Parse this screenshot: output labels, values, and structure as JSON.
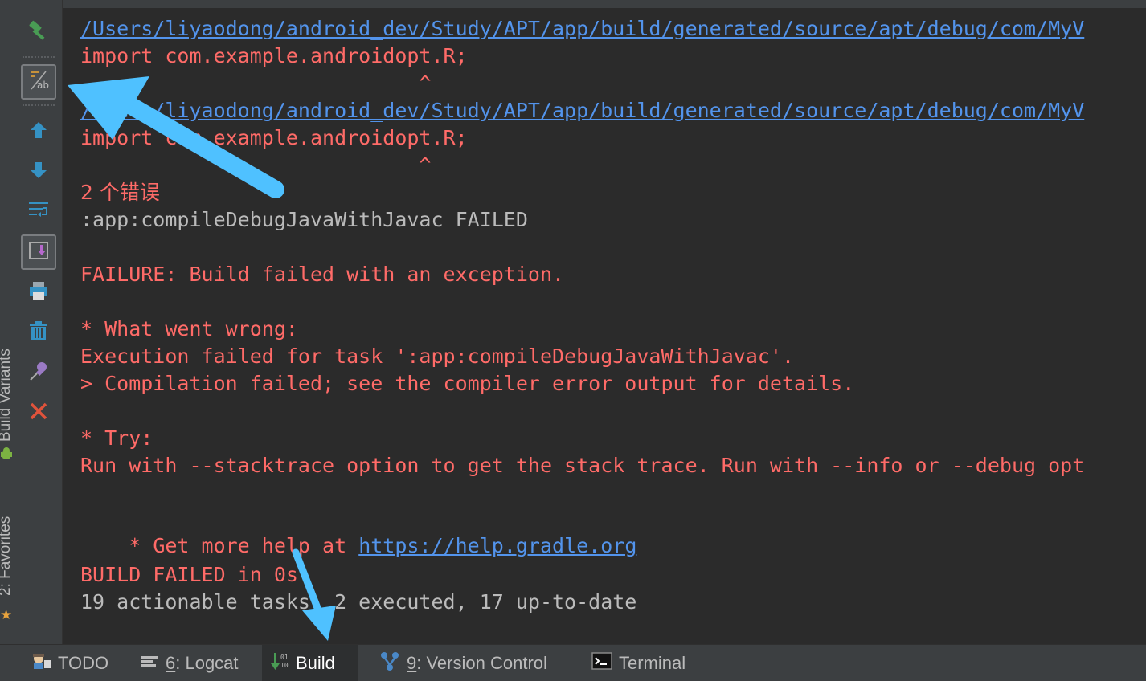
{
  "window": {
    "accent": "#4fc1ff"
  },
  "side_strip": {
    "build_variants_label": "Build Variants",
    "favorites_label": "2: Favorites"
  },
  "toolbar": {
    "items": [
      {
        "name": "build-hammer-icon"
      },
      {
        "name": "toggle-view-icon"
      },
      {
        "name": "up-arrow-icon"
      },
      {
        "name": "down-arrow-icon"
      },
      {
        "name": "soft-wrap-icon"
      },
      {
        "name": "scroll-to-end-icon"
      },
      {
        "name": "print-icon"
      },
      {
        "name": "trash-icon"
      },
      {
        "name": "pin-icon"
      },
      {
        "name": "close-icon"
      }
    ]
  },
  "console": {
    "lines": [
      {
        "text": "/Users/liyaodong/android_dev/Study/APT/app/build/generated/source/apt/debug/com/MyV",
        "style": "link"
      },
      {
        "text": "import com.example.androidopt.R;",
        "style": "red"
      },
      {
        "text": "                            ^",
        "style": "red"
      },
      {
        "text": "/Users/liyaodong/android_dev/Study/APT/app/build/generated/source/apt/debug/com/MyV",
        "style": "link"
      },
      {
        "text": "import com.example.androidopt.R;",
        "style": "red"
      },
      {
        "text": "                            ^",
        "style": "red"
      },
      {
        "text": "2 个错误",
        "style": "red"
      },
      {
        "text": ":app:compileDebugJavaWithJavac FAILED",
        "style": "gray"
      },
      {
        "text": "FAILURE: Build failed with an exception.",
        "style": "red"
      },
      {
        "text": "* What went wrong:",
        "style": "red"
      },
      {
        "text": "Execution failed for task ':app:compileDebugJavaWithJavac'.",
        "style": "red"
      },
      {
        "text": "> Compilation failed; see the compiler error output for details.",
        "style": "red"
      },
      {
        "text": "* Try:",
        "style": "red"
      },
      {
        "text": "Run with --stacktrace option to get the stack trace. Run with --info or --debug opt",
        "style": "red"
      },
      {
        "text": "* Get more help at ",
        "style": "red"
      },
      {
        "text": "https://help.gradle.org",
        "style": "link"
      },
      {
        "text": "BUILD FAILED in 0s",
        "style": "red"
      },
      {
        "text": "19 actionable tasks: 2 executed, 17 up-to-date",
        "style": "gray"
      }
    ]
  },
  "bottom_bar": {
    "tabs": [
      {
        "label": "TODO",
        "icon": "todo-icon"
      },
      {
        "mnemonic": "6",
        "label": ": Logcat",
        "icon": "logcat-icon"
      },
      {
        "label": "Build",
        "icon": "build-icon",
        "active": true
      },
      {
        "mnemonic": "9",
        "label": ": Version Control",
        "icon": "version-control-icon"
      },
      {
        "label": "Terminal",
        "icon": "terminal-icon"
      }
    ]
  }
}
